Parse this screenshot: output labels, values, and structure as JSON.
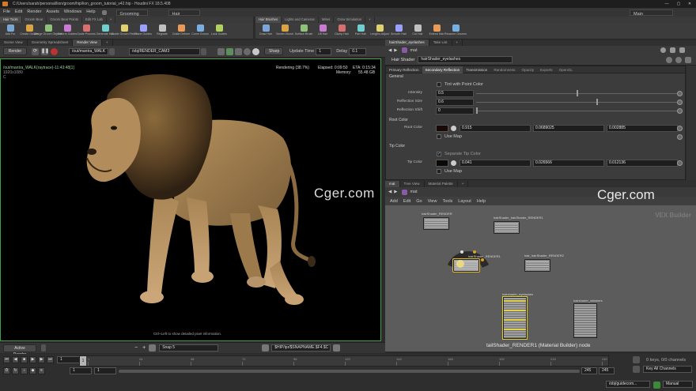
{
  "window": {
    "title": "C:/Users/sarah/personal/lion/groom/hip/lion_groom_tutorial_v42.hip - Houdini FX 18.5.408",
    "controls": [
      "—",
      "▢",
      "✕"
    ]
  },
  "menubar": {
    "items": [
      "File",
      "Edit",
      "Render",
      "Assets",
      "Windows",
      "Help"
    ],
    "desktop_left": "Grooming",
    "desktop_mid": "Hair",
    "desktop_right": "Main"
  },
  "shelf_left": {
    "tabs": [
      "Hair Tools",
      "Groom Bear",
      "Groom Bear Points",
      "Edit FX Lab"
    ],
    "active_tab": 0,
    "tools": [
      "Add Fur",
      "Create Guides",
      "Merge Groom Objects",
      "Deform Guides",
      "Guide Process",
      "Generate Hair",
      "Guide Groom Fields",
      "Plane Guides",
      "Regrade",
      "Guide Deform",
      "Curve Groom",
      "Lock Guides"
    ]
  },
  "shelf_right": {
    "tabs": [
      "Hair Brushes",
      "Lights and Cameras",
      "Wires",
      "Grow Simulation"
    ],
    "active_tab": 0,
    "tools": [
      "Draw Hair",
      "Screen Brush",
      "Surface Brush",
      "Lift Hair",
      "Clump Hair",
      "Part Hair",
      "Lengths Adjust",
      "Smooth Hair",
      "Cut Hair",
      "Extend Hair",
      "Recache Grooms"
    ]
  },
  "left_tabs": [
    "Scene View",
    "Geometry Spreadsheet",
    "Render View"
  ],
  "left_active_tab": 2,
  "right_tabs": [
    "hairShader_eyelashes",
    "Take List"
  ],
  "render_bar": {
    "render_label": "Render",
    "rop_path": "/out/mantra_WALK",
    "camera_path": "/obj/RENDER_CAM3",
    "sharp_label": "Sharp",
    "update_label": "Update Time",
    "update_value": "1",
    "delay_label": "Delay",
    "delay_value": "0.1"
  },
  "viewport": {
    "status_left": "/out/mantra_WALK(raytrace)-11:43:48[1]",
    "resolution": "1920x1080",
    "channel": "C",
    "rendering": "Rendering (38.7%)",
    "elapsed": "Elapsed: 0:09:50",
    "eta": "ETA: 0:15:34",
    "memory_label": "Memory:",
    "memory": "55.48 GB",
    "hint": "Ctrl+Left to show detailed pixel information.",
    "watermark": "Cger.com"
  },
  "viewport_footer": {
    "button": "Active Render",
    "snap": "Snap 5",
    "output_path": "$HIP/ipr/$SNAPNAME.$F4.$C"
  },
  "param_header": {
    "path": "mat",
    "node_type": "Hair Shader",
    "node_name": "hairShader_eyelashes"
  },
  "param_tabs": [
    "Primary Reflection",
    "Secondary Reflection",
    "Transmission",
    "Randomness",
    "Opacity",
    "Exports",
    "OpenGL"
  ],
  "param_active_tab": 1,
  "params": {
    "section_general": "General",
    "tint_label": "Tint with Point Color",
    "intensity_label": "Intensity",
    "intensity": "0.5",
    "intensity_frac": 0.5,
    "shift_label": "Reflection Size",
    "shift": "0.6",
    "shift_frac": 0.6,
    "refl_shift_label": "Reflection Shift",
    "refl_shift": "0",
    "refl_shift_frac": 0.0,
    "section_root": "Root Color",
    "root_label": "Root Color",
    "root_r": "0.915",
    "root_g": "0.0689025",
    "root_b": "0.002885",
    "use_map_label": "Use Map",
    "section_tip": "Tip Color",
    "sep_tip_label": "Separate Tip Color",
    "tip_label": "Tip Color",
    "tip_r": "0.041",
    "tip_g": "0.026566",
    "tip_b": "0.012136",
    "use_map2_label": "Use Map"
  },
  "network": {
    "tabs": [
      "mat",
      "Tree View",
      "Material Palette"
    ],
    "path": "mat",
    "menu": [
      "Add",
      "Edit",
      "Go",
      "View",
      "Tools",
      "Layout",
      "Help"
    ],
    "context_label": "VEX Builder",
    "watermark": "Cger.com",
    "selected_label": "tailShader_RENDER1 (Material Builder) node",
    "nodes": [
      "hairShader_RENDER",
      "hairShader_hairShader_RENDER1",
      "hairShader_RENDER1",
      "hair_hairShader_RENDER2",
      "hairshader_eyelashes",
      "hairshader_whiskers"
    ]
  },
  "timeline": {
    "frame": "1",
    "start": "1",
    "start2": "1",
    "end": "245",
    "end2": "245",
    "ticks": [
      "1",
      "24",
      "48",
      "72",
      "96",
      "120",
      "144",
      "168",
      "192",
      "216",
      "240"
    ],
    "keys_label": "0 keys, 0/0 channels",
    "channels_label": "Key All Channels",
    "path_field": "/obj/guidecom...",
    "manual_label": "Manual"
  }
}
